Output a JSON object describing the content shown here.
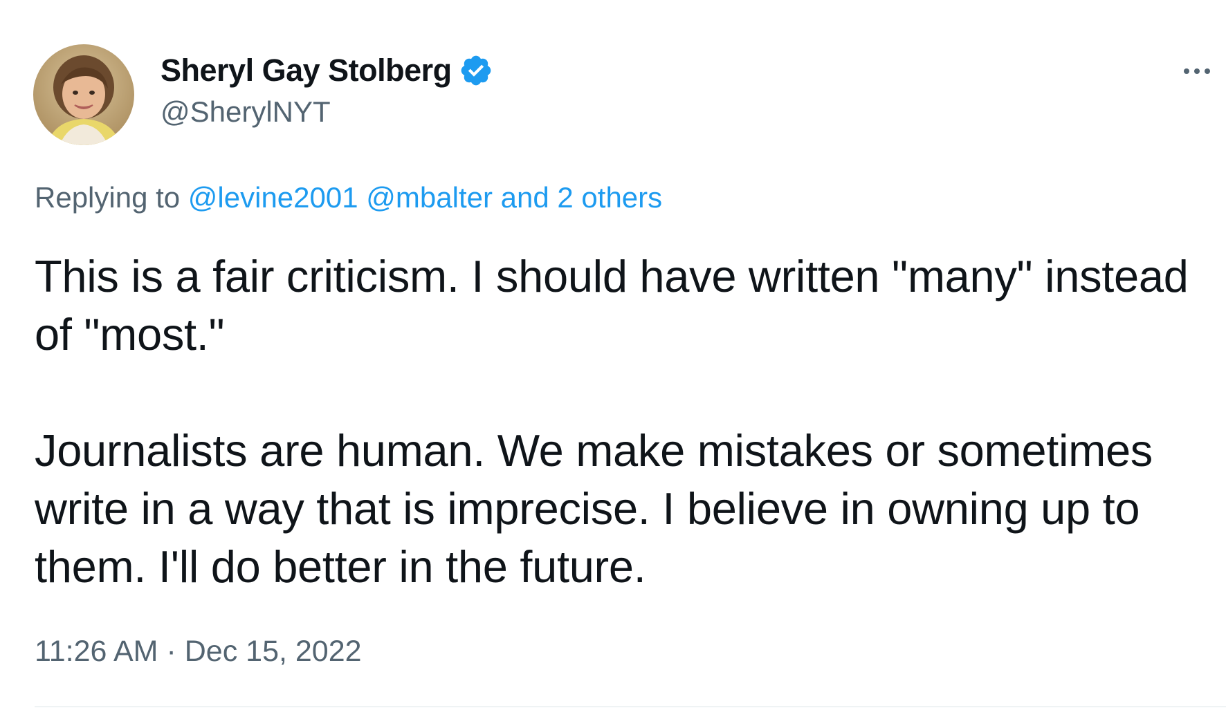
{
  "author": {
    "display_name": "Sheryl Gay Stolberg",
    "handle": "@SherylNYT",
    "verified": true,
    "verified_badge_color": "#1d9bf0",
    "avatar_icon": "profile-photo"
  },
  "menu": {
    "icon": "more-horizontal-icon"
  },
  "reply_context": {
    "prefix": "Replying to",
    "mentions": [
      "@levine2001",
      "@mbalter"
    ],
    "others": "and 2 others"
  },
  "tweet": {
    "paragraphs": [
      "This is a fair criticism. I should have written \"many\" instead of \"most.\"",
      "Journalists are human. We make mistakes or sometimes write in a way that is imprecise. I believe in owning up to them. I'll do better in the future."
    ]
  },
  "meta": {
    "time": "11:26 AM",
    "separator": "·",
    "date": "Dec 15, 2022"
  },
  "colors": {
    "text_primary": "#0f1419",
    "text_secondary": "#536471",
    "link": "#1d9bf0",
    "divider": "#eff3f4"
  }
}
